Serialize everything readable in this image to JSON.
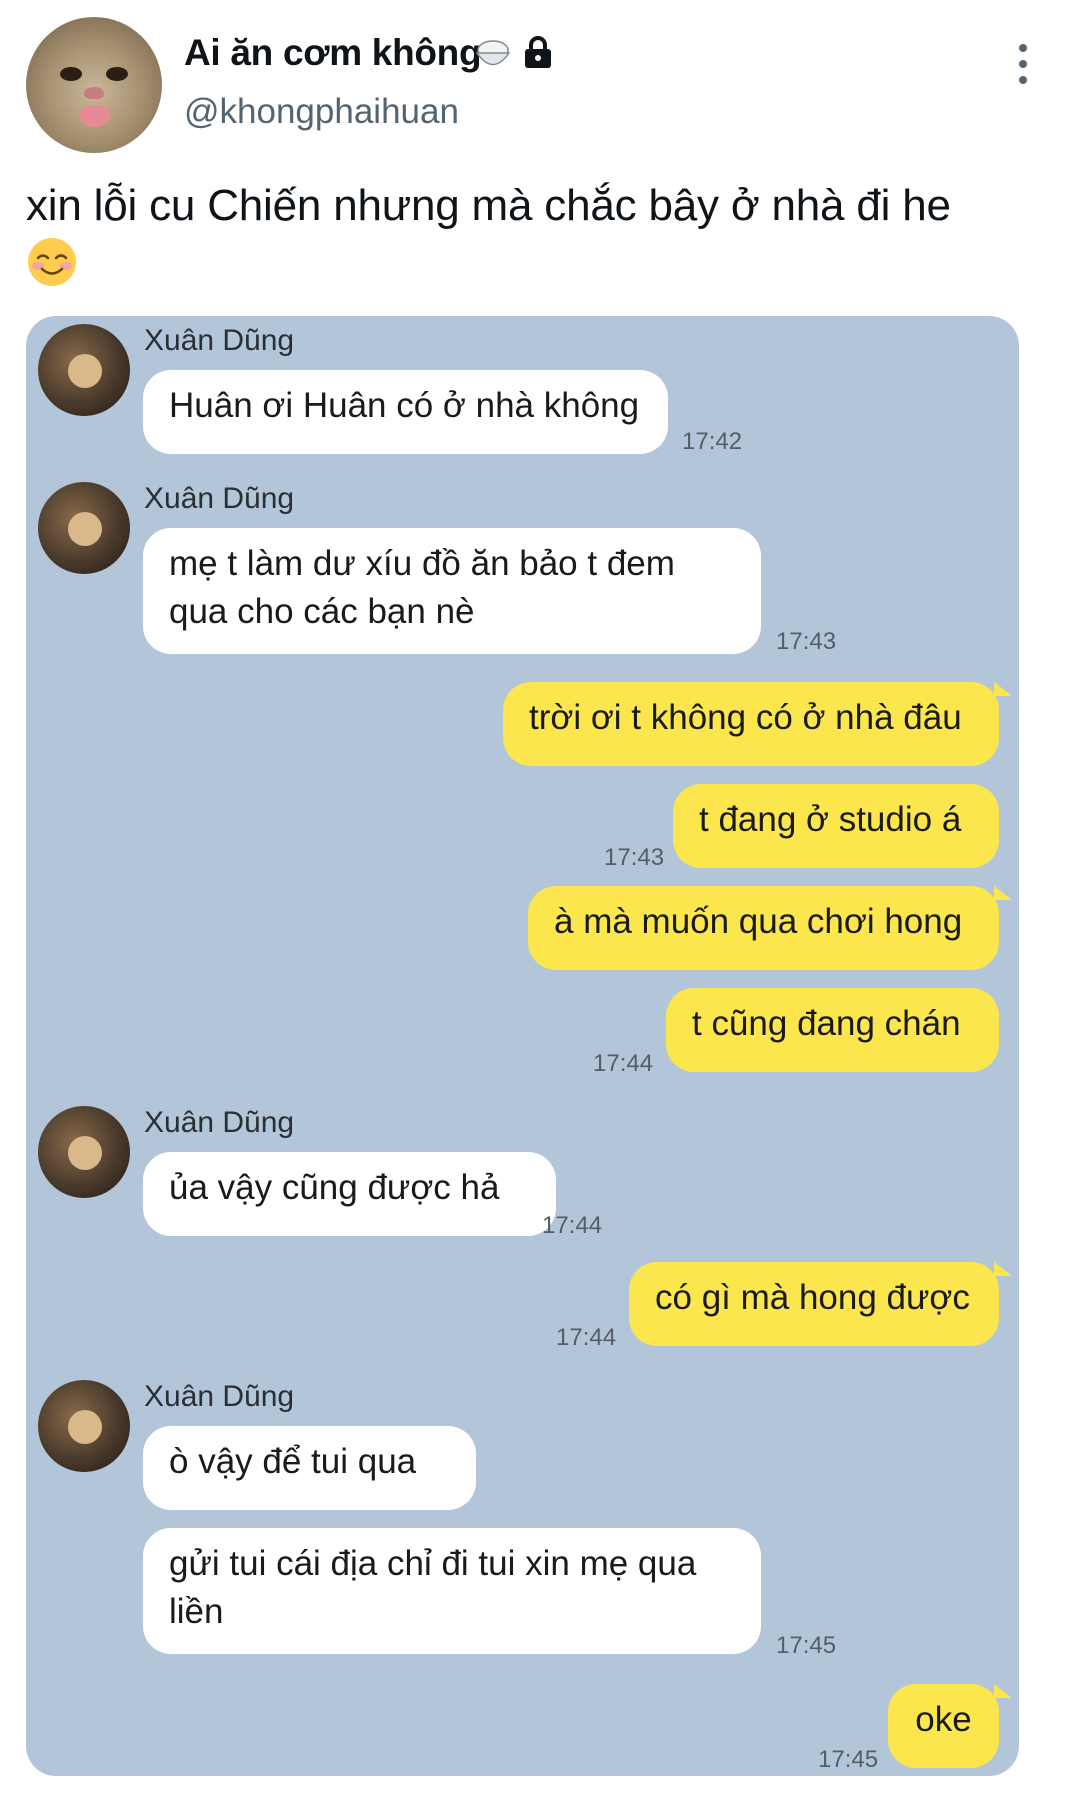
{
  "tweet": {
    "display_name": "Ai ăn cơm không",
    "handle": "@khongphaihuan",
    "text": "xin lỗi cu Chiến nhưng mà chắc bây ở nhà đi he",
    "icons": [
      "rice-bowl-emoji",
      "lock-icon",
      "more-vertical-icon",
      "smiling-face-emoji"
    ]
  },
  "chat": {
    "colors": {
      "background": "#b3c6d9",
      "incoming_bubble": "#ffffff",
      "outgoing_bubble": "#fbe64d"
    },
    "messages": [
      {
        "sender": "Xuân Dũng",
        "text": "Huân ơi Huân có ở nhà không",
        "time": "17:42",
        "direction": "incoming"
      },
      {
        "sender": "Xuân Dũng",
        "text": "mẹ t làm dư xíu đồ ăn bảo t đem qua cho các bạn nè",
        "time": "17:43",
        "direction": "incoming"
      },
      {
        "text": "trời ơi t không có ở nhà đâu",
        "direction": "outgoing"
      },
      {
        "text": "t đang ở studio á",
        "time": "17:43",
        "direction": "outgoing"
      },
      {
        "text": "à mà muốn qua chơi hong",
        "direction": "outgoing"
      },
      {
        "text": "t cũng đang chán",
        "time": "17:44",
        "direction": "outgoing"
      },
      {
        "sender": "Xuân Dũng",
        "text": "ủa vậy cũng được hả",
        "time": "17:44",
        "direction": "incoming"
      },
      {
        "text": "có gì mà hong được",
        "time": "17:44",
        "direction": "outgoing"
      },
      {
        "sender": "Xuân Dũng",
        "text": "ò vậy để tui qua",
        "direction": "incoming"
      },
      {
        "text": "gửi tui cái địa chỉ đi tui xin mẹ qua liền",
        "time": "17:45",
        "direction": "incoming"
      },
      {
        "text": "oke",
        "time": "17:45",
        "direction": "outgoing"
      }
    ]
  }
}
